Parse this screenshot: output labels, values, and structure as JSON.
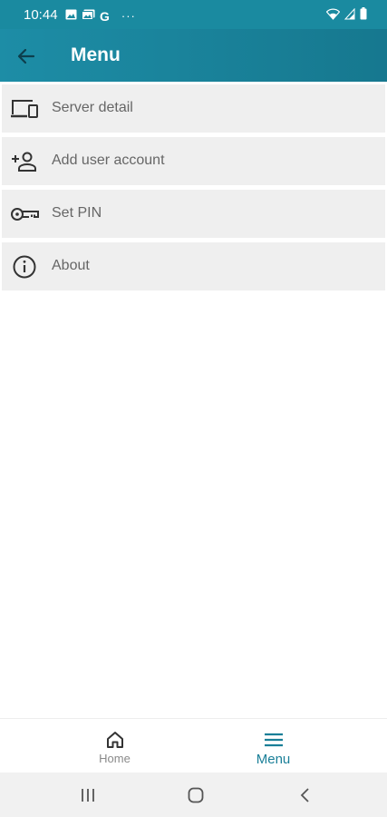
{
  "status_bar": {
    "time": "10:44",
    "g_label": "G",
    "more": "···"
  },
  "app_bar": {
    "title": "Menu",
    "back_icon": "arrow-back-icon"
  },
  "menu": {
    "items": [
      {
        "label": "Server detail",
        "icon": "devices-icon"
      },
      {
        "label": "Add user account",
        "icon": "add-person-icon"
      },
      {
        "label": "Set PIN",
        "icon": "key-icon"
      },
      {
        "label": "About",
        "icon": "info-icon"
      }
    ]
  },
  "bottom_nav": {
    "items": [
      {
        "label": "Home",
        "icon": "home-icon",
        "active": false
      },
      {
        "label": "Menu",
        "icon": "menu-lines-icon",
        "active": true
      }
    ]
  },
  "colors": {
    "accent": "#1a8aa0",
    "app_bar": "#17809a",
    "active_nav": "#1a7f98",
    "item_bg": "#efefef",
    "label": "#666666"
  }
}
